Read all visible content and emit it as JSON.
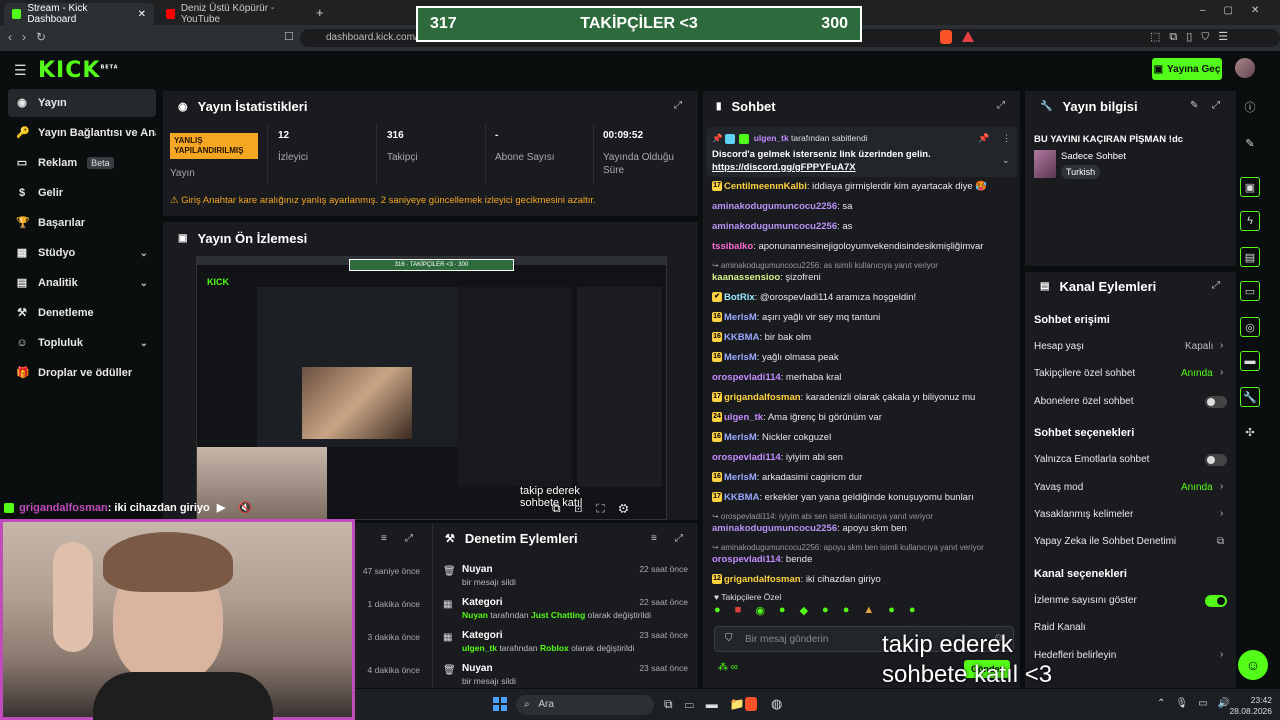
{
  "browser": {
    "tabs": [
      {
        "title": "Stream - Kick Dashboard",
        "active": true,
        "favicon_color": "#53fc18"
      },
      {
        "title": "Deniz Üstü Köpürür - YouTube",
        "active": false,
        "favicon_color": "#ff0000"
      }
    ],
    "new_tab": "+",
    "url": "dashboard.kick.com/st"
  },
  "scoreboard": {
    "left": "317",
    "center": "TAKİPÇİLER <3",
    "right": "300"
  },
  "header": {
    "logo": "KICK",
    "logo_sup": "BETA",
    "go_live": "Yayına Geç"
  },
  "sidebar": {
    "items": [
      {
        "label": "Yayın",
        "icon": "broadcast-icon",
        "glyph": "◉",
        "active": true,
        "chevron": false
      },
      {
        "label": "Yayın Bağlantısı ve Anahtarı",
        "icon": "key-icon",
        "glyph": "🔑",
        "chevron": false
      },
      {
        "label": "Reklam",
        "icon": "ad-icon",
        "glyph": "▭",
        "badge": "Beta",
        "chevron": false
      },
      {
        "label": "Gelir",
        "icon": "money-icon",
        "glyph": "$",
        "chevron": false
      },
      {
        "label": "Başarılar",
        "icon": "trophy-icon",
        "glyph": "🏆",
        "chevron": false
      },
      {
        "label": "Stüdyo",
        "icon": "studio-icon",
        "glyph": "▦",
        "chevron": true
      },
      {
        "label": "Analitik",
        "icon": "chart-icon",
        "glyph": "▤",
        "chevron": true
      },
      {
        "label": "Denetleme",
        "icon": "hammer-icon",
        "glyph": "⚒",
        "chevron": false
      },
      {
        "label": "Topluluk",
        "icon": "community-icon",
        "glyph": "☺",
        "chevron": true
      },
      {
        "label": "Droplar ve ödüller",
        "icon": "gift-icon",
        "glyph": "🎁",
        "chevron": false
      }
    ]
  },
  "stats": {
    "title": "Yayın İstatistikleri",
    "badge": "YANLIŞ YAPILANDIRILMIŞ",
    "badge_label": "Yayın",
    "items": [
      {
        "value": "12",
        "label": "İzleyici"
      },
      {
        "value": "316",
        "label": "Takipçi"
      },
      {
        "value": "-",
        "label": "Abone Sayısı"
      },
      {
        "value": "00:09:52",
        "label": "Yayında Olduğu Süre"
      }
    ],
    "warning": "Giriş Anahtar kare aralığınız yanlış ayarlanmış. 2 saniyeye güncellemek izleyici gecikmesini azaltır."
  },
  "preview": {
    "title": "Yayın Ön İzlemesi",
    "overlay_text": "takip ederek sohbete katıl"
  },
  "moderation": {
    "title": "Denetim Eylemleri",
    "left_times": [
      "47 saniye önce",
      "1 dakika önce",
      "3 dakika önce",
      "4 dakika önce"
    ],
    "items": [
      {
        "title": "Nuyan",
        "sub": "bir mesajı sildi",
        "time": "22 saat önce",
        "icon": "trash-icon"
      },
      {
        "title": "Kategori",
        "sub_pre": "Nuyan",
        "sub_mid": " tarafından ",
        "sub_hl": "Just Chatting",
        "sub_post": " olarak değiştirildi",
        "time": "22 saat önce",
        "icon": "category-icon"
      },
      {
        "title": "Kategori",
        "sub_pre": "ulgen_tk",
        "sub_mid": " tarafından ",
        "sub_hl": "Roblox",
        "sub_post": " olarak değiştirildi",
        "time": "23 saat önce",
        "icon": "category-icon"
      },
      {
        "title": "Nuyan",
        "sub": "bir mesajı sildi",
        "time": "23 saat önce",
        "icon": "trash-icon"
      }
    ]
  },
  "webcam_chat": {
    "user": "grigandalfosman",
    "text": ": iki cihazdan giriyo"
  },
  "chat": {
    "title": "Sohbet",
    "pinned": {
      "user": "ulgen_tk",
      "by": "tarafından sabitlendi",
      "text": "Discord'a gelmek isterseniz link üzerinden gelin.",
      "link": "https://discord.gg/gFPPYFuA7X"
    },
    "lines": [
      {
        "type": "msg",
        "badge": "17",
        "user": "CentilmeenınKalbi",
        "color": "#ffd23f",
        "text": ": iddiaya girmişlerdir kim ayartacak diye 🥵"
      },
      {
        "type": "msg",
        "user": "aminakodugumuncocu2256",
        "color": "#b794f6",
        "text": ": sa"
      },
      {
        "type": "msg",
        "user": "aminakodugumuncocu2256",
        "color": "#b794f6",
        "text": ": as"
      },
      {
        "type": "msg",
        "user": "tssibalko",
        "color": "#ff6ad5",
        "text": ": aponunannesinejigoloyumvekendisindesikmişliğimvar"
      },
      {
        "type": "reply",
        "text": "↪ aminakodugumuncocu2256: as isimli kullanıcıya yanıt veriyor"
      },
      {
        "type": "msg",
        "user": "kaanassensioo",
        "color": "#d4f28a",
        "text": ": şizofreni"
      },
      {
        "type": "msg",
        "badge": "✔",
        "user": "BotRix",
        "color": "#9aeaff",
        "text": ": @orospevladi114 aramıza hoşgeldin!"
      },
      {
        "type": "msg",
        "badge": "16",
        "user": "MerlsM",
        "color": "#9aa8ff",
        "text": ": aşırı yağlı vir sey mq tantuni"
      },
      {
        "type": "msg",
        "badge": "16",
        "user": "KKBMA",
        "color": "#9aa8ff",
        "text": ": bir bak olm"
      },
      {
        "type": "msg",
        "badge": "16",
        "user": "MerlsM",
        "color": "#9aa8ff",
        "text": ": yağlı olmasa peak"
      },
      {
        "type": "msg",
        "user": "orospevladi114",
        "color": "#c38cff",
        "text": ": merhaba kral"
      },
      {
        "type": "msg",
        "badge": "17",
        "user": "grigandalfosman",
        "color": "#ffd23f",
        "text": ": karadenizli olarak çakala yı biliyonuz mu"
      },
      {
        "type": "msg",
        "badge": "24",
        "user": "ulgen_tk",
        "color": "#c38cff",
        "text": ": Ama iğrenç bi görünüm var"
      },
      {
        "type": "msg",
        "badge": "16",
        "user": "MerlsM",
        "color": "#9aa8ff",
        "text": ": Nickler cokguzel"
      },
      {
        "type": "msg",
        "user": "orospevladi114",
        "color": "#c38cff",
        "text": ": iyiyim abi sen"
      },
      {
        "type": "msg",
        "badge": "16",
        "user": "MerlsM",
        "color": "#9aa8ff",
        "text": ": arkadasimi cagiricm dur"
      },
      {
        "type": "msg",
        "badge": "17",
        "user": "KKBMA",
        "color": "#9aa8ff",
        "text": ": erkekler yan yana geldiğinde konuşuyomu bunları"
      },
      {
        "type": "reply",
        "text": "↪ orospevladi114: iyiyim abi sen isimli kullanıcıya yanıt veriyor"
      },
      {
        "type": "msg",
        "user": "aminakodugumuncocu2256",
        "color": "#b794f6",
        "text": ": apoyu skm ben"
      },
      {
        "type": "reply",
        "text": "↪ aminakodugumuncocu2256: apoyu skm ben isimli kullanıcıya yanıt veriyor"
      },
      {
        "type": "msg",
        "user": "orospevladi114",
        "color": "#c38cff",
        "text": ": bende"
      },
      {
        "type": "msg",
        "badge": "12",
        "user": "grigandalfosman",
        "color": "#ffd23f",
        "text": ": iki cihazdan giriyo"
      }
    ],
    "followers_label": "♥ Takipçilere Özel",
    "input_placeholder": "Bir mesaj gönderin",
    "send": "Gönder"
  },
  "stream_info": {
    "title": "Yayın bilgisi",
    "stream_title": "BU YAYINI KAÇIRAN PİŞMAN !dc",
    "category": "Sadece Sohbet",
    "tag": "Turkish"
  },
  "channel_actions": {
    "title": "Kanal Eylemleri",
    "chat_access": "Sohbet erişimi",
    "account_age": {
      "label": "Hesap yaşı",
      "value": "Kapalı"
    },
    "followers_chat": {
      "label": "Takipçilere özel sohbet",
      "value": "Anında"
    },
    "subs_chat": {
      "label": "Abonelere özel sohbet",
      "on": false
    },
    "chat_options": "Sohbet seçenekleri",
    "emote_only": {
      "label": "Yalnızca Emotlarla sohbet",
      "on": false
    },
    "slow_mode": {
      "label": "Yavaş mod",
      "value": "Anında"
    },
    "banned_words": {
      "label": "Yasaklanmış kelimeler"
    },
    "ai_moderation": {
      "label": "Yapay Zeka ile Sohbet Denetimi"
    },
    "channel_options": "Kanal seçenekleri",
    "show_viewers": {
      "label": "İzlenme sayısını göster",
      "on": true
    },
    "raid": {
      "label": "Raid Kanalı"
    },
    "goals": {
      "label": "Hedefleri belirleyin"
    }
  },
  "overlay_caption": {
    "line1": "takip ederek",
    "line2": "sohbete katıl <3"
  },
  "taskbar": {
    "search": "Ara",
    "time": "23:42",
    "date": "28.08.2026"
  },
  "colors": {
    "kick_green": "#53fc18",
    "warning": "#f5a623",
    "bg": "#0b0e0f",
    "panel": "#191b1f",
    "webcam_border": "#c04bbd",
    "score_green": "#2e6b3c"
  }
}
